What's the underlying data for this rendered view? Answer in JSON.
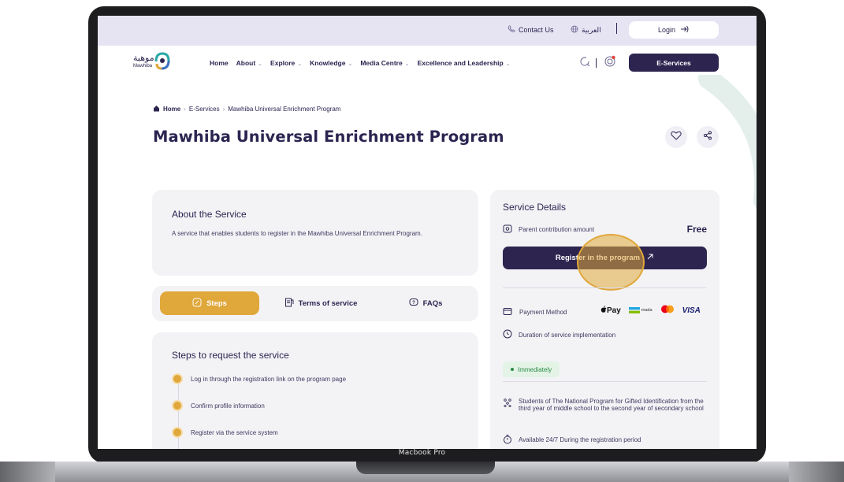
{
  "device": {
    "model_label": "Macbook Pro"
  },
  "topbar": {
    "contact_label": "Contact Us",
    "lang_label": "العربية",
    "login_label": "Login"
  },
  "nav": {
    "logo_ar": "موهبة",
    "logo_en": "Mawhiba",
    "items": [
      {
        "label": "Home",
        "dropdown": false
      },
      {
        "label": "About",
        "dropdown": true
      },
      {
        "label": "Explore",
        "dropdown": true
      },
      {
        "label": "Knowledge",
        "dropdown": true
      },
      {
        "label": "Media Centre",
        "dropdown": true
      },
      {
        "label": "Excellence and Leadership",
        "dropdown": true
      }
    ],
    "eservices_label": "E-Services"
  },
  "breadcrumb": {
    "home": "Home",
    "eservices": "E-Services",
    "current": "Mawhiba Universal Enrichment Program"
  },
  "page": {
    "title": "Mawhiba Universal Enrichment Program"
  },
  "about": {
    "title": "About the Service",
    "description": "A service that enables students to register in the Mawhiba Universal Enrichment Program."
  },
  "tabs": {
    "steps": "Steps",
    "terms": "Terms of service",
    "faqs": "FAQs"
  },
  "steps": {
    "title": "Steps to request the service",
    "items": [
      "Log in through the registration link on the program page",
      "Confirm profile information",
      "Register via the service system"
    ]
  },
  "details": {
    "title": "Service Details",
    "contribution_label": "Parent contribution amount",
    "contribution_value": "Free",
    "register_label": "Register in the program",
    "payment_label": "Payment Method",
    "pay_logos": {
      "apple_pay": "Pay",
      "mada": "mada",
      "visa": "VISA"
    },
    "duration_label": "Duration of service implementation",
    "duration_value": "Immediately",
    "eligibility": "Students of The National Program for Gifted Identification from the third year of middle school to the second year of secondary school",
    "availability": "Available 24/7 During the registration period"
  },
  "colors": {
    "primary": "#2d2450",
    "accent": "#e0a73a",
    "topbar": "#e6e4f3",
    "card": "#f3f3f6",
    "success": "#2e8a45"
  }
}
